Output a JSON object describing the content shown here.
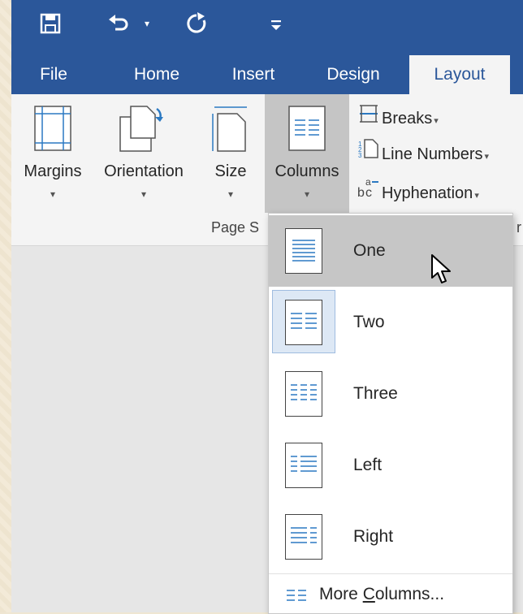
{
  "quick_access": {
    "icons": [
      "save-icon",
      "undo-icon",
      "redo-icon",
      "customize-icon"
    ]
  },
  "tabs": [
    {
      "label": "File"
    },
    {
      "label": "Home"
    },
    {
      "label": "Insert"
    },
    {
      "label": "Design"
    },
    {
      "label": "Layout",
      "active": true
    }
  ],
  "ribbon": {
    "margins_label": "Margins",
    "orientation_label": "Orientation",
    "size_label": "Size",
    "columns_label": "Columns",
    "breaks_label": "Breaks",
    "line_numbers_label": "Line Numbers",
    "hyphenation_label": "Hyphenation",
    "group_page_setup": "Page S",
    "group_paragraph_partial": "r"
  },
  "columns_menu": {
    "items": [
      {
        "label": "One",
        "state": "hover"
      },
      {
        "label": "Two",
        "state": "selected"
      },
      {
        "label": "Three"
      },
      {
        "label": "Left"
      },
      {
        "label": "Right"
      }
    ],
    "more_label_prefix": "More ",
    "more_label_accel": "C",
    "more_label_suffix": "olumns..."
  },
  "colors": {
    "brand_blue": "#2b579a",
    "ribbon_bg": "#f4f4f4",
    "hover_gray": "#c6c6c6",
    "selected_blue": "#dde8f5"
  }
}
